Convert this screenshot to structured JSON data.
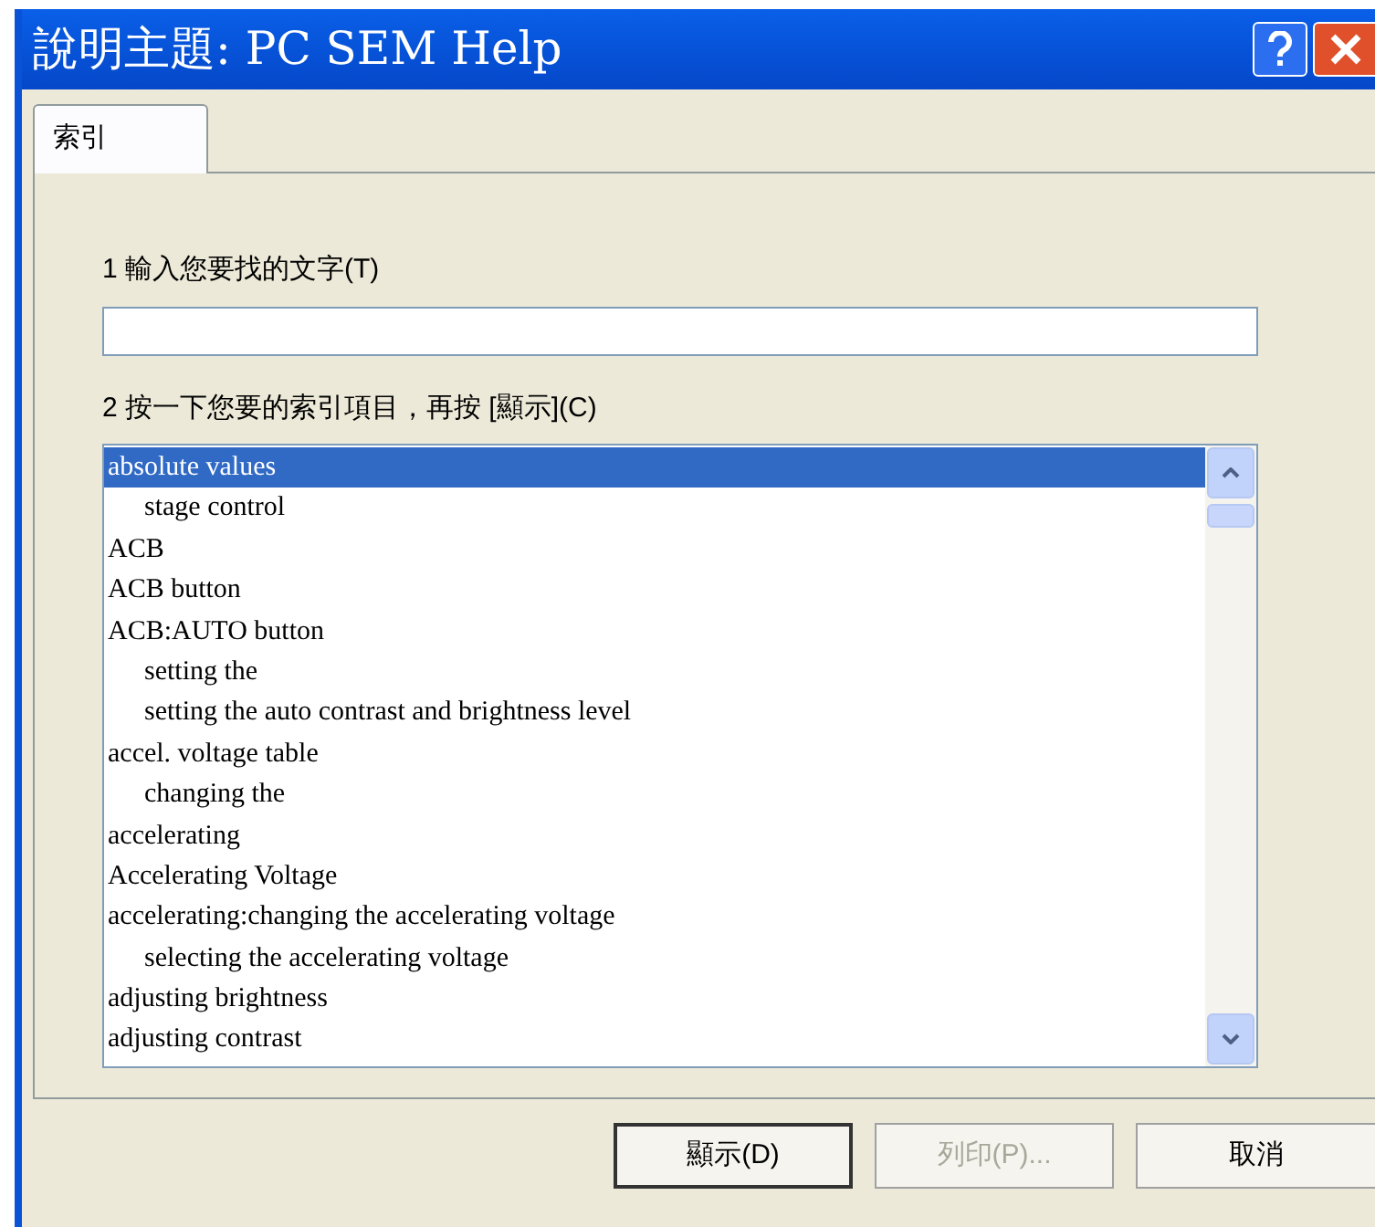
{
  "window": {
    "title": "說明主題: PC SEM Help"
  },
  "tabs": [
    {
      "label": "索引",
      "selected": true
    }
  ],
  "step_1": {
    "label": "1  輸入您要找的文字(T)"
  },
  "step_2": {
    "label": "2  按一下您要的索引項目，再按 [顯示](C)"
  },
  "index_list": [
    {
      "label": "absolute values",
      "selected": true,
      "children": [
        {
          "label": "stage control",
          "selected": false
        }
      ]
    },
    {
      "label": "ACB",
      "selected": false
    },
    {
      "label": "ACB button",
      "selected": false
    },
    {
      "label": "ACB:AUTO button",
      "selected": false,
      "children": [
        {
          "label": "setting the",
          "selected": false
        },
        {
          "label": "setting the auto contrast and brightness level",
          "selected": false
        }
      ]
    },
    {
      "label": "accel. voltage table",
      "selected": false,
      "children": [
        {
          "label": "changing the",
          "selected": false
        }
      ]
    },
    {
      "label": "accelerating",
      "selected": false
    },
    {
      "label": "Accelerating Voltage",
      "selected": false
    },
    {
      "label": "accelerating:changing the accelerating voltage",
      "selected": false,
      "children": [
        {
          "label": "selecting the accelerating voltage",
          "selected": false
        }
      ]
    },
    {
      "label": "adjusting brightness",
      "selected": false
    },
    {
      "label": "adjusting contrast",
      "selected": false
    }
  ],
  "buttons": [
    {
      "label": "顯示(D)",
      "default": true,
      "disabled": false
    },
    {
      "label": "列印(P)...",
      "default": false,
      "disabled": true
    },
    {
      "label": "取消",
      "default": false,
      "disabled": false
    }
  ]
}
